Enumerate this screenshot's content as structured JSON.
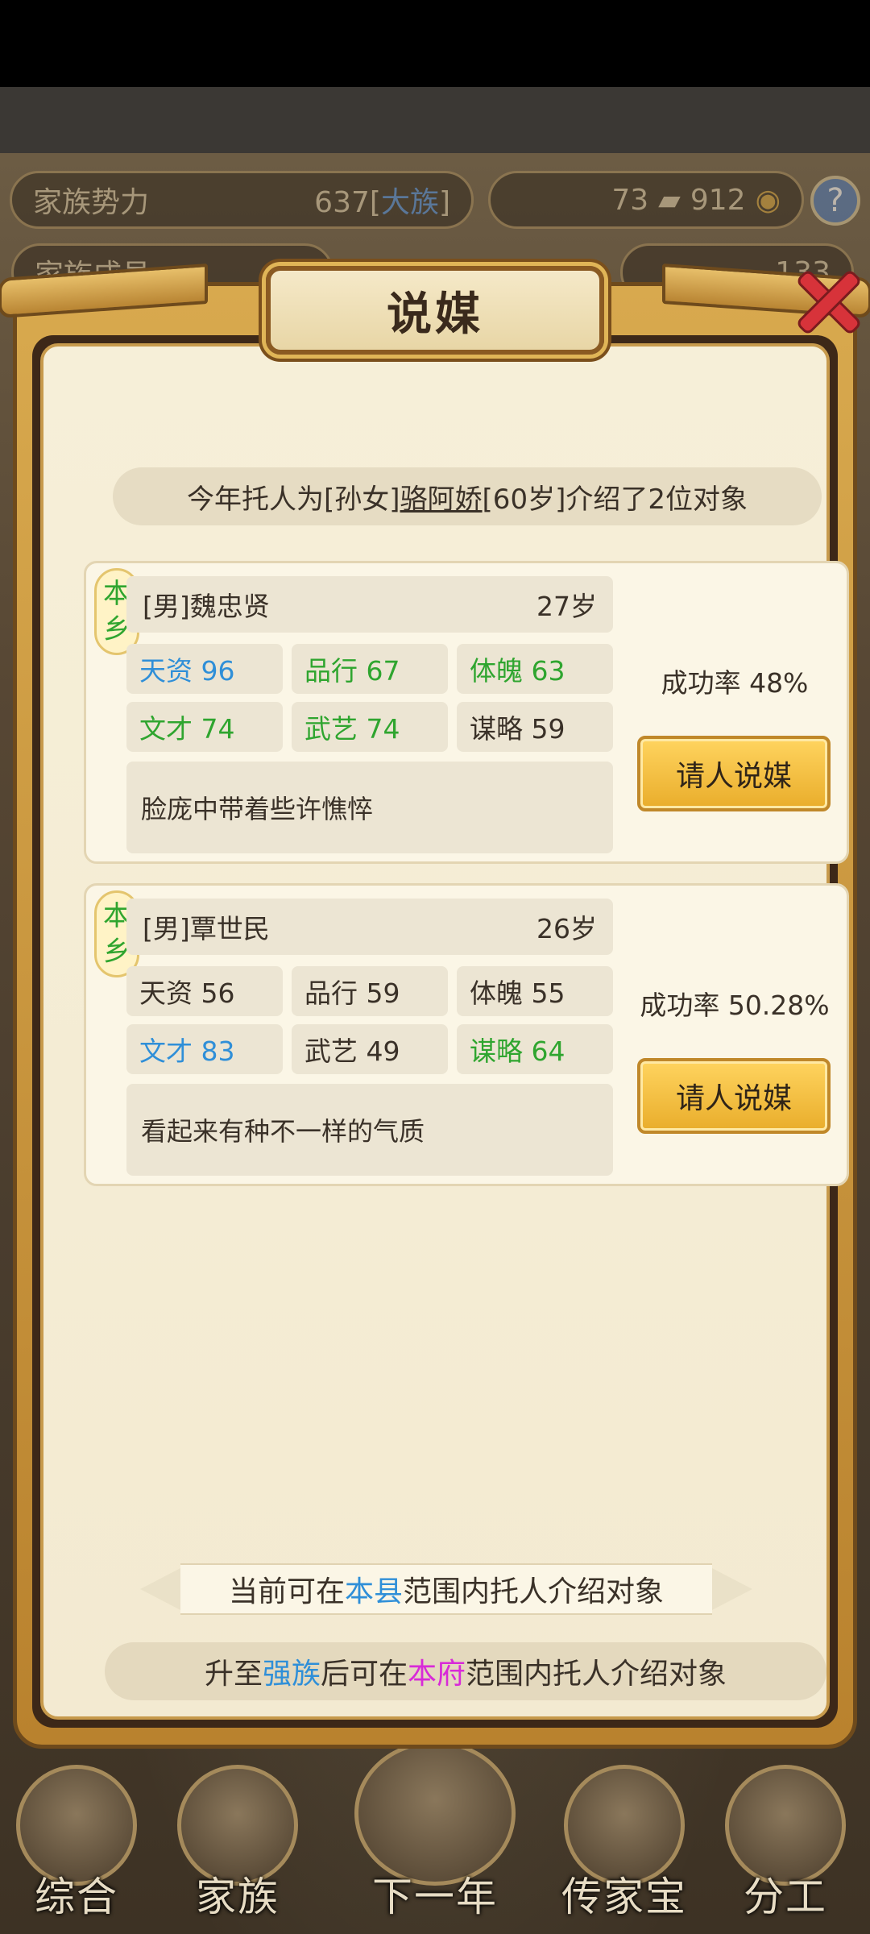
{
  "top_bar": {
    "clan_power_label": "家族势力",
    "clan_power_value": "637",
    "clan_rank": "大族",
    "resource_a": "73",
    "resource_b": "912",
    "clan_members_label": "家族成员",
    "gold": "133"
  },
  "modal": {
    "title": "说媒",
    "intro_prefix": "今年托人为[孙女]",
    "intro_name": "骆阿娇",
    "intro_suffix": "[60岁]介绍了2位对象",
    "candidates": [
      {
        "origin_line1": "本",
        "origin_line2": "乡",
        "name": "[男]魏忠贤",
        "age": "27岁",
        "stats": [
          {
            "label": "天资 96",
            "color": "blue"
          },
          {
            "label": "品行 67",
            "color": "green"
          },
          {
            "label": "体魄 63",
            "color": "green"
          },
          {
            "label": "文才 74",
            "color": "green"
          },
          {
            "label": "武艺 74",
            "color": "green"
          },
          {
            "label": "谋略 59",
            "color": "normal"
          }
        ],
        "description": "脸庞中带着些许憔悴",
        "success_rate": "成功率 48%",
        "button": "请人说媒"
      },
      {
        "origin_line1": "本",
        "origin_line2": "乡",
        "name": "[男]覃世民",
        "age": "26岁",
        "stats": [
          {
            "label": "天资 56",
            "color": "normal"
          },
          {
            "label": "品行 59",
            "color": "normal"
          },
          {
            "label": "体魄 55",
            "color": "normal"
          },
          {
            "label": "文才 83",
            "color": "blue"
          },
          {
            "label": "武艺 49",
            "color": "normal"
          },
          {
            "label": "谋略 64",
            "color": "green"
          }
        ],
        "description": "看起来有种不一样的气质",
        "success_rate": "成功率 50.28%",
        "button": "请人说媒"
      }
    ],
    "range_prefix": "当前可在",
    "range_place": "本县",
    "range_suffix": "范围内托人介绍对象",
    "upgrade_prefix": "升至",
    "upgrade_rank": "强族",
    "upgrade_mid": "后可在",
    "upgrade_place": "本府",
    "upgrade_suffix": "范围内托人介绍对象"
  },
  "bottom_nav": [
    "综合",
    "家族",
    "下一年",
    "传家宝",
    "分工"
  ],
  "colors": {
    "blue": "#2f8fd8",
    "green": "#2fa52f",
    "magenta": "#d82ad8",
    "gold_button": "#f0b93a"
  }
}
